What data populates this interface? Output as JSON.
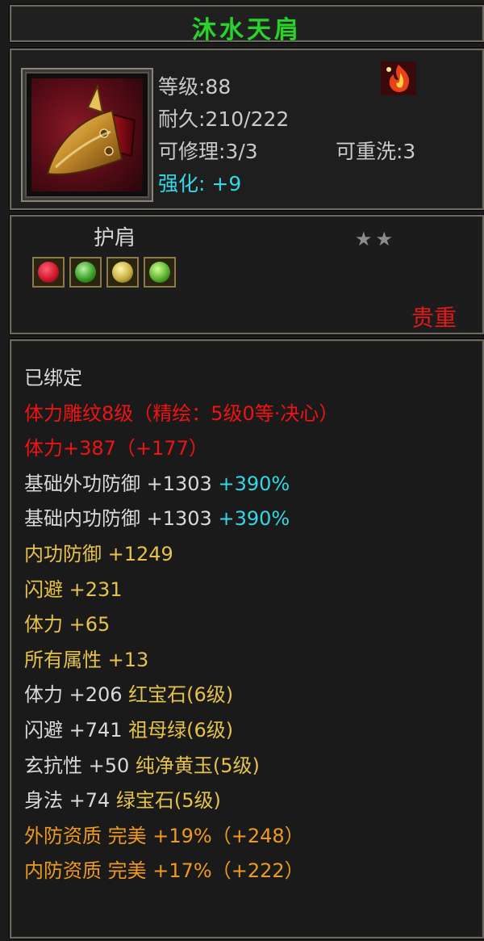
{
  "item": {
    "name": "沐水天肩",
    "level_line": "等级:88",
    "durability_line": "耐久:210/222",
    "repair_line": "可修理:3/3",
    "reroll_line": "可重洗:3",
    "enhance_label": "强化:",
    "enhance_value": "+9",
    "type": "护肩",
    "stars": "★★",
    "quality": "贵重",
    "icon": "golden-pauldron-icon",
    "badge_icon": "flame-emblem-icon"
  },
  "gems": [
    {
      "icon": "red-gem-icon",
      "color": "#d01830"
    },
    {
      "icon": "green-gem-icon",
      "color": "#3aa02a"
    },
    {
      "icon": "yellow-jade-icon",
      "color": "#c8b040"
    },
    {
      "icon": "emerald-gem-icon",
      "color": "#58b030"
    }
  ],
  "stats": [
    {
      "parts": [
        {
          "text": "已绑定",
          "color": "white"
        }
      ]
    },
    {
      "parts": [
        {
          "text": "体力雕纹8级（精绘：5级0等·决心）",
          "color": "red"
        }
      ]
    },
    {
      "parts": [
        {
          "text": "体力+387（+177）",
          "color": "red"
        }
      ]
    },
    {
      "parts": [
        {
          "text": "基础外功防御 +1303",
          "color": "white"
        },
        {
          "text": " +390%",
          "color": "cyan"
        }
      ]
    },
    {
      "parts": [
        {
          "text": "基础内功防御 +1303",
          "color": "white"
        },
        {
          "text": " +390%",
          "color": "cyan"
        }
      ]
    },
    {
      "parts": [
        {
          "text": "内功防御 +1249",
          "color": "yellow"
        }
      ]
    },
    {
      "parts": [
        {
          "text": "闪避 +231",
          "color": "yellow"
        }
      ]
    },
    {
      "parts": [
        {
          "text": "体力 +65",
          "color": "yellow"
        }
      ]
    },
    {
      "parts": [
        {
          "text": "所有属性 +13",
          "color": "yellow"
        }
      ]
    },
    {
      "parts": [
        {
          "text": "体力 +206",
          "color": "white"
        },
        {
          "text": " 红宝石(6级)",
          "color": "yellow"
        }
      ]
    },
    {
      "parts": [
        {
          "text": "闪避 +741",
          "color": "white"
        },
        {
          "text": " 祖母绿(6级)",
          "color": "yellow"
        }
      ]
    },
    {
      "parts": [
        {
          "text": "玄抗性 +50",
          "color": "white"
        },
        {
          "text": " 纯净黄玉(5级)",
          "color": "yellow"
        }
      ]
    },
    {
      "parts": [
        {
          "text": "身法 +74",
          "color": "white"
        },
        {
          "text": " 绿宝石(5级)",
          "color": "yellow"
        }
      ]
    },
    {
      "parts": [
        {
          "text": "外防资质  完美 +19%（+248）",
          "color": "orange"
        }
      ]
    },
    {
      "parts": [
        {
          "text": "内防资质  完美 +17%（+222）",
          "color": "orange"
        }
      ]
    }
  ]
}
